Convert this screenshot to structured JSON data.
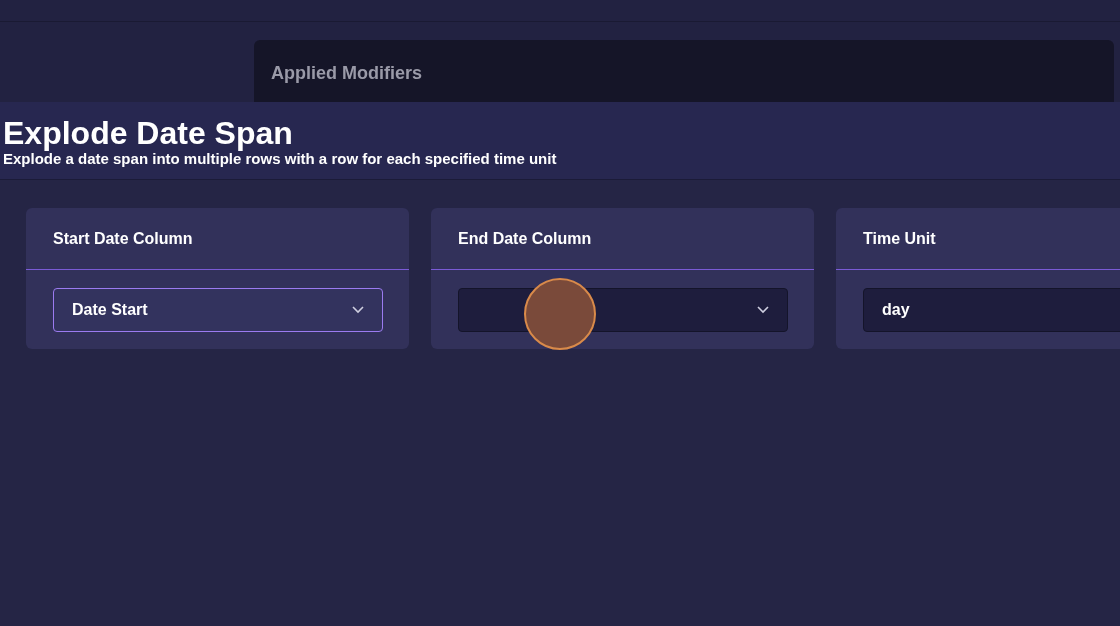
{
  "applied_modifiers": {
    "title": "Applied Modifiers"
  },
  "modifier": {
    "title": "Explode Date Span",
    "description": "Explode a date span into multiple rows with a row for each specified time unit"
  },
  "fields": [
    {
      "label": "Start Date Column",
      "value": "Date Start",
      "focused": true
    },
    {
      "label": "End Date Column",
      "focused": false
    },
    {
      "label": "Time Unit",
      "value": "day",
      "focused": false
    }
  ],
  "click_marker": {
    "shown": true
  }
}
